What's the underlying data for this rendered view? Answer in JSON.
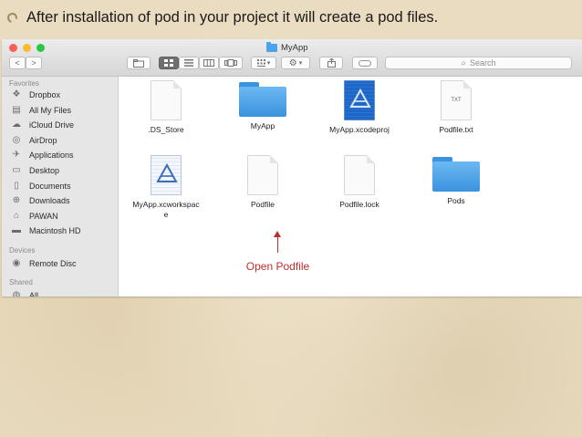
{
  "headline": "After installation of pod in your project it will create a pod files.",
  "window": {
    "title": "MyApp"
  },
  "toolbar": {
    "back": "<",
    "forward": ">",
    "search_label": "Search"
  },
  "sidebar": {
    "favorites_title": "Favorites",
    "favorites": [
      {
        "label": "Dropbox",
        "icon": "dropbox-icon"
      },
      {
        "label": "All My Files",
        "icon": "all-files-icon"
      },
      {
        "label": "iCloud Drive",
        "icon": "cloud-icon"
      },
      {
        "label": "AirDrop",
        "icon": "airdrop-icon"
      },
      {
        "label": "Applications",
        "icon": "applications-icon"
      },
      {
        "label": "Desktop",
        "icon": "desktop-icon"
      },
      {
        "label": "Documents",
        "icon": "documents-icon"
      },
      {
        "label": "Downloads",
        "icon": "downloads-icon"
      },
      {
        "label": "PAWAN",
        "icon": "home-folder-icon"
      },
      {
        "label": "Macintosh HD",
        "icon": "hard-drive-icon"
      }
    ],
    "devices_title": "Devices",
    "devices": [
      {
        "label": "Remote Disc",
        "icon": "disc-icon"
      }
    ],
    "shared_title": "Shared",
    "shared": [
      {
        "label": "All...",
        "icon": "network-icon"
      }
    ]
  },
  "files": [
    {
      "name": ".DS_Store",
      "kind": "document"
    },
    {
      "name": "MyApp",
      "kind": "folder"
    },
    {
      "name": "MyApp.xcodeproj",
      "kind": "xcodeproj"
    },
    {
      "name": "Podfile.txt",
      "kind": "text",
      "ext": "TXT"
    },
    {
      "name": "MyApp.xcworkspace",
      "kind": "xcworkspace",
      "display_line1": "MyApp.xcworkspac",
      "display_line2": "e"
    },
    {
      "name": "Podfile",
      "kind": "document"
    },
    {
      "name": "Podfile.lock",
      "kind": "document"
    },
    {
      "name": "Pods",
      "kind": "folder"
    }
  ],
  "callout": {
    "text": "Open Podfile"
  },
  "colors": {
    "background": "#e9dcc0",
    "folder": "#3a93de",
    "callout": "#c12d2d",
    "traffic_red": "#fc5f57",
    "traffic_yellow": "#fdbc2e",
    "traffic_green": "#28c840"
  }
}
